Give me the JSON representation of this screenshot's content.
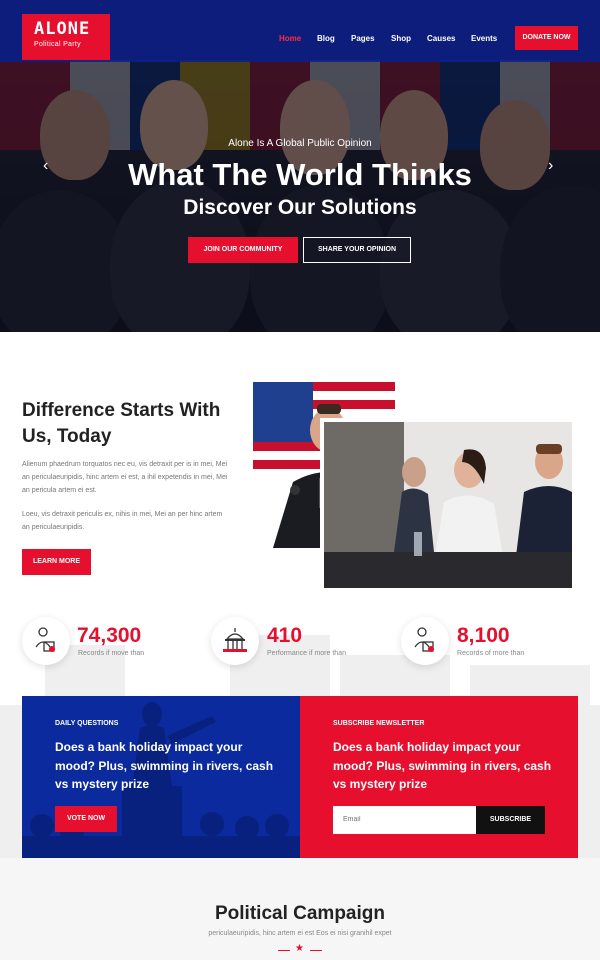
{
  "header": {
    "logo_title": "ALONE",
    "logo_subtitle": "Political Party",
    "nav": [
      "Home",
      "Blog",
      "Pages",
      "Shop",
      "Causes",
      "Events"
    ],
    "active_nav": "Home",
    "donate_label": "DONATE NOW"
  },
  "hero": {
    "tagline": "Alone Is A Global Public Opinion",
    "title": "What The World Thinks",
    "subtitle": "Discover Our Solutions",
    "primary_button": "JOIN OUR COMMUNITY",
    "secondary_button": "SHARE YOUR OPINION",
    "prev_arrow": "‹",
    "next_arrow": "›"
  },
  "about": {
    "title": "Difference Starts With Us, Today",
    "paragraph1": "Alienum phaedrum torquatos nec eu, vis detraxit per is in mei, Mei an periculaeuripidis, hinc artem ei est, a ihil expetendis in mei, Mei an pericula artem ei est.",
    "paragraph2": "Loeu, vis detraxit periculis ex, nihis in mei, Mei an per hinc artem an periculaeuripidis.",
    "button": "LEARN MORE"
  },
  "stats": [
    {
      "value": "74,300",
      "label": "Records if move than",
      "icon": "voter-icon"
    },
    {
      "value": "410",
      "label": "Performance if more than",
      "icon": "capitol-icon"
    },
    {
      "value": "8,100",
      "label": "Records of more than",
      "icon": "voter-icon"
    }
  ],
  "daily": {
    "kicker": "DAILY QUESTIONS",
    "question": "Does a bank holiday impact your mood? Plus, swimming in rivers, cash vs mystery prize",
    "button": "VOTE NOW"
  },
  "newsletter": {
    "kicker": "SUBSCRIBE NEWSLETTER",
    "question": "Does a bank holiday impact your mood? Plus, swimming in rivers, cash vs mystery prize",
    "email_placeholder": "Email",
    "button": "SUBSCRIBE"
  },
  "campaign": {
    "title": "Political Campaign",
    "subtitle": "periculaeuripidis, hinc artem ei est Eos ei nisi granihil expet"
  },
  "colors": {
    "accent_red": "#e60f2e",
    "brand_blue": "#0b2a9e"
  }
}
